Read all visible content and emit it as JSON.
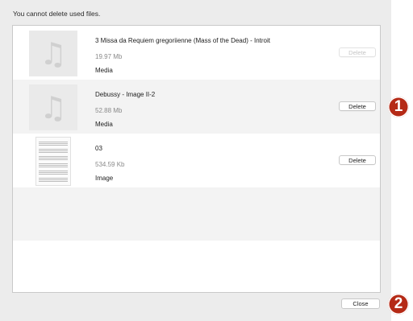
{
  "dialog": {
    "notice": "You cannot delete used files.",
    "close_label": "Close"
  },
  "files": [
    {
      "title": "3 Missa da Requiem gregoriienne (Mass of the Dead) - Introit",
      "size": "19.97 Mb",
      "type": "Media",
      "thumb": "music-note-icon",
      "delete_label": "Delete",
      "delete_enabled": false
    },
    {
      "title": "Debussy - Image II-2",
      "size": "52.88 Mb",
      "type": "Media",
      "thumb": "music-note-icon",
      "delete_label": "Delete",
      "delete_enabled": true
    },
    {
      "title": "03",
      "size": "534.59 Kb",
      "type": "Image",
      "thumb": "sheet-music-thumbnail",
      "delete_label": "Delete",
      "delete_enabled": true
    }
  ],
  "callouts": [
    "1",
    "2"
  ],
  "colors": {
    "callout": "#b52a16",
    "dialog_bg": "#ececec",
    "disabled_text": "#c5c5c5"
  }
}
